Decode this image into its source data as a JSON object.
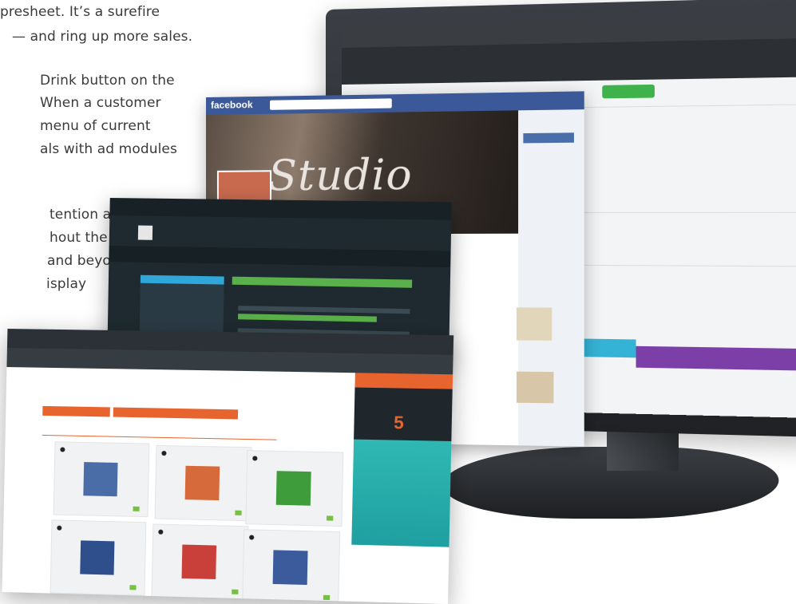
{
  "copy": {
    "lines": [
      "presheet. It’s a surefire",
      "— and ring up more sales.",
      "Drink button on the",
      "When a customer",
      "menu of current",
      "als with ad modules",
      "tention and",
      "hout the",
      "and beyond,",
      "isplay"
    ]
  },
  "facebook": {
    "logo": "facebook",
    "cover_title": "Studio"
  },
  "front_window": {
    "stat_number": "5"
  },
  "colors": {
    "facebook_blue": "#3b5998",
    "accent_orange": "#e8642f",
    "accent_green": "#5ab04a",
    "accent_teal": "#2fb8b3",
    "accent_purple": "#7b3fa7",
    "accent_blue": "#30a7d9"
  }
}
